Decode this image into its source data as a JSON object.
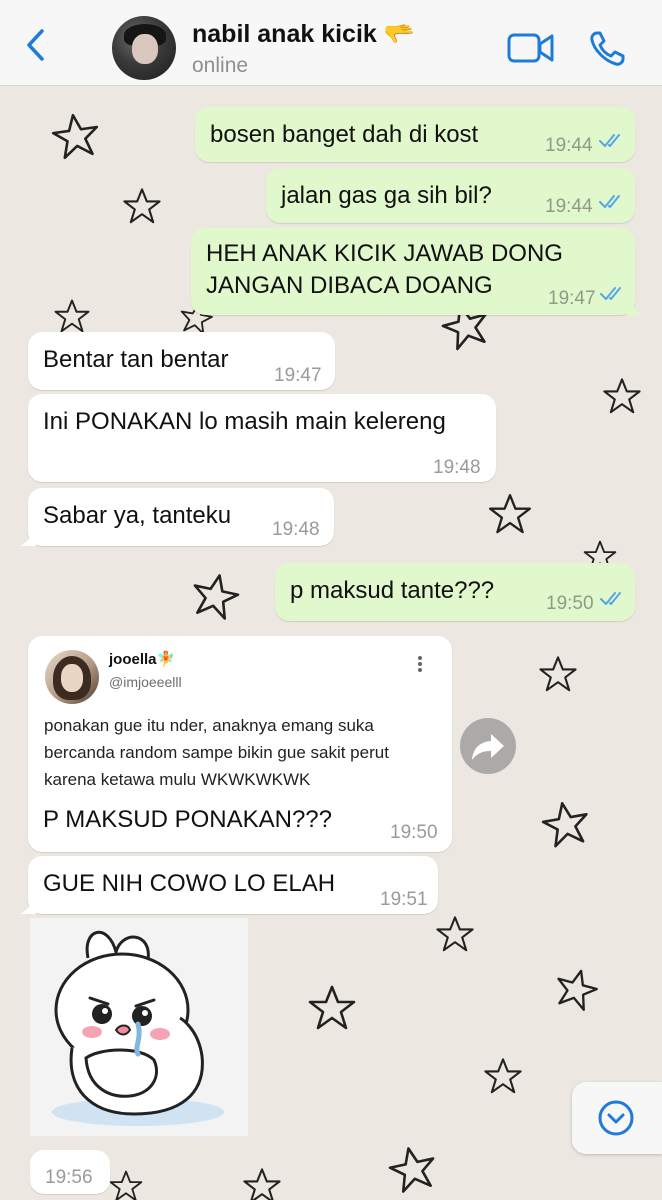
{
  "header": {
    "back_icon": "chevron-left-icon",
    "contact_name": "nabil anak kicik 🫳",
    "status": "online",
    "video_icon": "video-camera-icon",
    "call_icon": "phone-icon"
  },
  "messages": [
    {
      "direction": "out",
      "text": "bosen banget dah di kost",
      "time": "19:44",
      "read": true
    },
    {
      "direction": "out",
      "text": "jalan gas ga sih bil?",
      "time": "19:44",
      "read": true
    },
    {
      "direction": "out",
      "lines": [
        "HEH ANAK KICIK JAWAB DONG",
        "JANGAN DIBACA DOANG"
      ],
      "time": "19:47",
      "read": true
    },
    {
      "direction": "in",
      "text": "Bentar tan bentar",
      "time": "19:47"
    },
    {
      "direction": "in",
      "text": "Ini PONAKAN lo masih main kelereng",
      "time": "19:48"
    },
    {
      "direction": "in",
      "text": "Sabar ya, tanteku",
      "time": "19:48"
    },
    {
      "direction": "out",
      "text": "p maksud tante???",
      "time": "19:50",
      "read": true
    },
    {
      "direction": "in",
      "type": "tweet",
      "tweet": {
        "name": "jooella🧚",
        "handle": "@imjoeeelll",
        "lines": [
          "ponakan gue itu nder, anaknya emang suka",
          "bercanda random sampe bikin gue sakit perut",
          "karena ketawa mulu WKWKWKWK"
        ]
      },
      "text": "P MAKSUD PONAKAN???",
      "time": "19:50"
    },
    {
      "direction": "in",
      "text": "GUE NIH COWO LO ELAH",
      "time": "19:51"
    },
    {
      "direction": "in",
      "type": "sticker",
      "sticker_name": "crying-bunny-sticker",
      "time": "19:56"
    }
  ],
  "colors": {
    "accent": "#1f7bd8",
    "outgoing_bubble": "#e1f8cc",
    "incoming_bubble": "#ffffff",
    "wallpaper": "#ece8e1",
    "read_ticks": "#53a6e8"
  },
  "icons": {
    "share": "forward-arrow-icon",
    "scroll": "chevron-down-circle-icon",
    "more": "vertical-dots-icon"
  }
}
